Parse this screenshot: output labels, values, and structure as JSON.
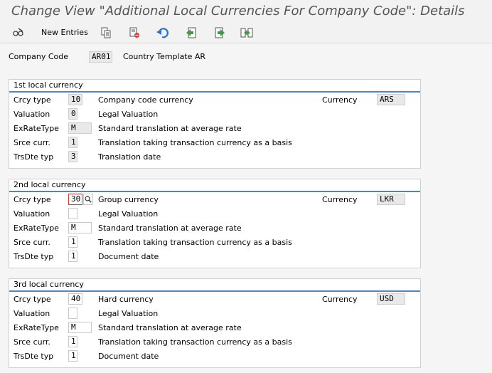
{
  "title": "Change View \"Additional Local Currencies For Company Code\": Details",
  "toolbar": {
    "new_entries_label": "New Entries"
  },
  "header": {
    "company_code_label": "Company Code",
    "company_code_value": "AR01",
    "company_name": "Country Template AR"
  },
  "groups": [
    {
      "title": "1st local currency",
      "rows": [
        {
          "label": "Crcy type",
          "value": "10",
          "desc": "Company code currency"
        },
        {
          "label": "Valuation",
          "value": "0",
          "desc": "Legal Valuation"
        },
        {
          "label": "ExRateType",
          "value": "M",
          "desc": "Standard translation at average rate"
        },
        {
          "label": "Srce curr.",
          "value": "1",
          "desc": "Translation taking transaction currency as a basis"
        },
        {
          "label": "TrsDte typ",
          "value": "3",
          "desc": "Translation date"
        }
      ],
      "currency_label": "Currency",
      "currency_value": "ARS"
    },
    {
      "title": "2nd local currency",
      "rows": [
        {
          "label": "Crcy type",
          "value": "30",
          "desc": "Group currency"
        },
        {
          "label": "Valuation",
          "value": "",
          "desc": "Legal Valuation"
        },
        {
          "label": "ExRateType",
          "value": "M",
          "desc": "Standard translation at average rate"
        },
        {
          "label": "Srce curr.",
          "value": "1",
          "desc": "Translation taking transaction currency as a basis"
        },
        {
          "label": "TrsDte typ",
          "value": "1",
          "desc": "Document date"
        }
      ],
      "currency_label": "Currency",
      "currency_value": "LKR"
    },
    {
      "title": "3rd local currency",
      "rows": [
        {
          "label": "Crcy type",
          "value": "40",
          "desc": "Hard currency"
        },
        {
          "label": "Valuation",
          "value": "",
          "desc": "Legal Valuation"
        },
        {
          "label": "ExRateType",
          "value": "M",
          "desc": "Standard translation at average rate"
        },
        {
          "label": "Srce curr.",
          "value": "1",
          "desc": "Translation taking transaction currency as a basis"
        },
        {
          "label": "TrsDte typ",
          "value": "1",
          "desc": "Document date"
        }
      ],
      "currency_label": "Currency",
      "currency_value": "USD"
    }
  ],
  "colors": {
    "accent": "#4a86c8",
    "focus_border": "#d33a3a"
  }
}
